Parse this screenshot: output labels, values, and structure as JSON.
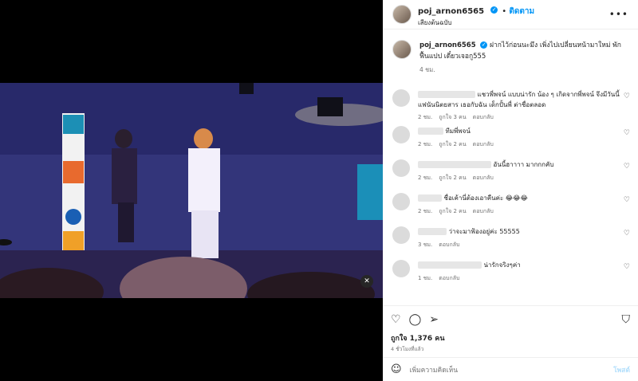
{
  "header": {
    "username": "poj_arnon6565",
    "follow_label": "ติดตาม",
    "subtitle": "เสียงต้นฉบับ",
    "more": "•••"
  },
  "caption": {
    "username": "poj_arnon6565",
    "text": "ฝากไว้ก่อนนะมึง  เพิ่งไปเปลี่ยนหน้ามาใหม่ พักฟื้นแปป เดี๋ยวเจอกู555",
    "time": "4 ชม."
  },
  "comments": [
    {
      "text": "แชวพี่พจน์ แบบน่ารัก น้อง ๆ เกิดจากพี่พจน์ จึงมีวันนี้ แฟนันนิตยสาร เธอกับฉัน เด็กปั้นพี่ ต่าชื่อตลอด",
      "time": "2 ชม.",
      "likes": "ถูกใจ 3 คน",
      "reply": "ตอบกลับ"
    },
    {
      "text": "ทีมพี่พจน์",
      "time": "2 ชม.",
      "likes": "ถูกใจ 2 คน",
      "reply": "ตอบกลับ"
    },
    {
      "text": "อันนี้ฮาาาา มากกกคับ",
      "time": "2 ชม.",
      "likes": "ถูกใจ 2 คน",
      "reply": "ตอบกลับ"
    },
    {
      "text": "ชื่อเค้านี่ต้องเอาคืนค่ะ 😂😂😂",
      "time": "2 ชม.",
      "likes": "ถูกใจ 2 คน",
      "reply": "ตอบกลับ"
    },
    {
      "text": "ว่าจะมาฟ้องอยู่ค่ะ 55555",
      "time": "3 ชม.",
      "likes": "",
      "reply": "ตอบกลับ"
    },
    {
      "text": "น่ารักจริงๆค่า",
      "time": "1 ชม.",
      "likes": "",
      "reply": "ตอบกลับ"
    }
  ],
  "actions": {
    "likes": "ถูกใจ 1,376 คน",
    "ago": "4 ชั่วโมงที่แล้ว"
  },
  "add_comment": {
    "placeholder": "เพิ่มความคิดเห็น",
    "post": "โพสต์"
  }
}
